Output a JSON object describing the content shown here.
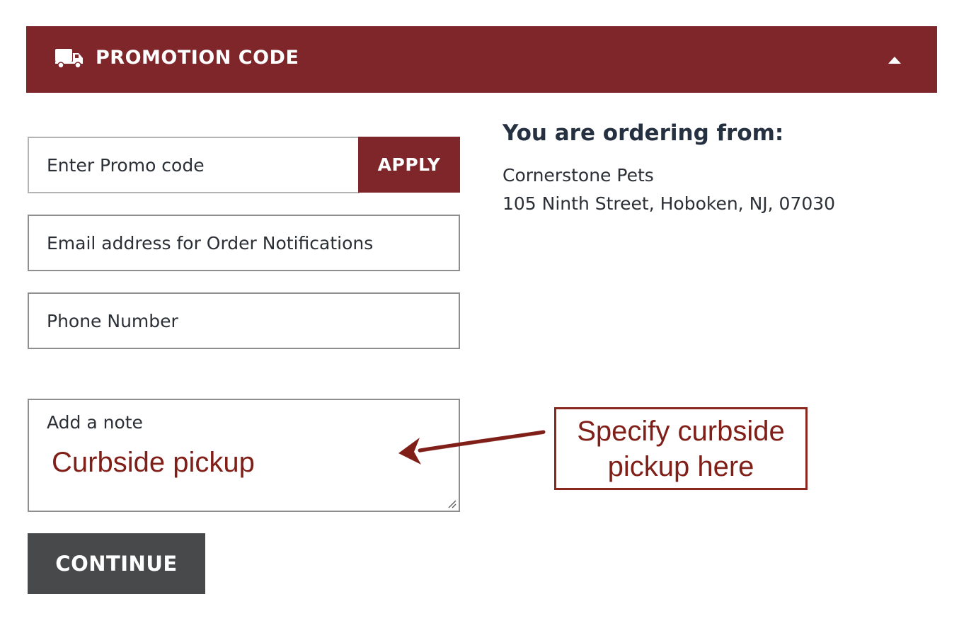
{
  "header": {
    "title": "PROMOTION CODE",
    "icon": "truck-icon",
    "toggle_icon": "caret-up-icon",
    "background_color": "#7f262b"
  },
  "form": {
    "promo": {
      "placeholder": "Enter Promo code",
      "apply_label": "APPLY"
    },
    "email": {
      "placeholder": "Email address for Order Notifications"
    },
    "phone": {
      "placeholder": "Phone Number"
    },
    "note": {
      "label": "Add a note",
      "value": "Curbside pickup"
    },
    "continue_label": "CONTINUE"
  },
  "store": {
    "heading": "You are ordering from:",
    "name": "Cornerstone Pets",
    "address": "105 Ninth Street, Hoboken, NJ, 07030"
  },
  "annotation": {
    "callout": "Specify curbside pickup here",
    "color": "#7f1f18"
  }
}
